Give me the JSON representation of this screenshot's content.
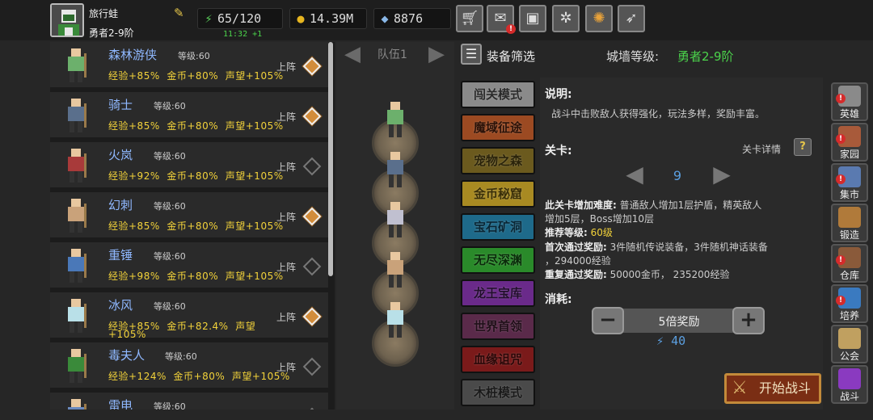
{
  "player": {
    "name": "旅行蛙",
    "rank": "勇者2-9阶",
    "avatar_icon": "pixel-knight-portrait"
  },
  "resources": {
    "stamina": "65/120",
    "stamina_regen": "11:32 +1",
    "gold": "14.39M",
    "gems": "8876"
  },
  "top_buttons": [
    {
      "name": "shop",
      "icon": "cart-icon"
    },
    {
      "name": "mail",
      "icon": "mail-icon",
      "badge": "!"
    },
    {
      "name": "game",
      "icon": "gamepad-icon"
    },
    {
      "name": "settings",
      "icon": "gear-icon"
    },
    {
      "name": "gacha",
      "icon": "color-wheel-icon"
    },
    {
      "name": "feather",
      "icon": "feather-icon"
    }
  ],
  "heroes": [
    {
      "name": "森林游侠",
      "level": "等级:60",
      "xp": "经验+85%",
      "gold": "金币+80%",
      "fame": "声望+105%",
      "deploy": "上阵",
      "active": true,
      "color": "#6cb06c"
    },
    {
      "name": "骑士",
      "level": "等级:60",
      "xp": "经验+85%",
      "gold": "金币+80%",
      "fame": "声望+105%",
      "deploy": "上阵",
      "active": true,
      "color": "#5a6f8c"
    },
    {
      "name": "火岚",
      "level": "等级:60",
      "xp": "经验+92%",
      "gold": "金币+80%",
      "fame": "声望+105%",
      "deploy": "上阵",
      "active": false,
      "color": "#a83a3a"
    },
    {
      "name": "幻刺",
      "level": "等级:60",
      "xp": "经验+85%",
      "gold": "金币+80%",
      "fame": "声望+105%",
      "deploy": "上阵",
      "active": true,
      "color": "#c9a27a"
    },
    {
      "name": "重锤",
      "level": "等级:60",
      "xp": "经验+98%",
      "gold": "金币+80%",
      "fame": "声望+105%",
      "deploy": "上阵",
      "active": false,
      "color": "#4a78b8"
    },
    {
      "name": "冰风",
      "level": "等级:60",
      "xp": "经验+85%",
      "gold": "金币+82.4%",
      "fame": "声望",
      "fame_wrap": "+105%",
      "deploy": "上阵",
      "active": true,
      "color": "#b9e0e8"
    },
    {
      "name": "毒夫人",
      "level": "等级:60",
      "xp": "经验+124%",
      "gold": "金币+80%",
      "fame": "声望+105%",
      "deploy": "上阵",
      "active": false,
      "color": "#3a8a3a"
    },
    {
      "name": "雷电",
      "level": "等级:60",
      "xp": "",
      "gold": "",
      "fame": "",
      "deploy": "",
      "active": false,
      "color": "#6a8abf"
    }
  ],
  "team": {
    "label": "队伍1",
    "slots": [
      "#6cb06c",
      "#5a6f8c",
      "#c0c0d0",
      "#c9a27a",
      "#b9e0e8"
    ]
  },
  "right_header": {
    "filter_label": "装备筛选",
    "wall_label": "城墙等级:",
    "wall_value": "勇者2-9阶"
  },
  "modes": [
    {
      "label": "闯关模式",
      "bg": "#8a8a8a",
      "fg": "#2a2a2a"
    },
    {
      "label": "魔域征途",
      "bg": "#9c4a22",
      "fg": "#2b1208"
    },
    {
      "label": "宠物之森",
      "bg": "#6b5a1e",
      "fg": "#2a230a"
    },
    {
      "label": "金币秘窟",
      "bg": "#a88a22",
      "fg": "#3a2f08"
    },
    {
      "label": "宝石矿洞",
      "bg": "#1e6a8a",
      "fg": "#0a2634"
    },
    {
      "label": "无尽深渊",
      "bg": "#2a8a2a",
      "fg": "#0a2a0a"
    },
    {
      "label": "龙王宝库",
      "bg": "#6a2a8a",
      "fg": "#22102c"
    },
    {
      "label": "世界首领",
      "bg": "#5a2a4a",
      "fg": "#201019"
    },
    {
      "label": "血缘诅咒",
      "bg": "#7a1a1a",
      "fg": "#2a0808"
    },
    {
      "label": "木桩模式",
      "bg": "#4a4a4a",
      "fg": "#1a1a1a"
    }
  ],
  "detail": {
    "desc_title": "说明:",
    "desc_text": "战斗中击败敌人获得强化，玩法多样，奖励丰富。",
    "stage_title": "关卡:",
    "stage_detail_label": "关卡详情",
    "stage_number": "9",
    "difficulty_label": "此关卡增加难度:",
    "difficulty_text1": "普通敌人增加1层护盾，精英敌人",
    "difficulty_text2": "增加5层，Boss增加10层",
    "recommend_label": "推荐等级:",
    "recommend_value": "60级",
    "first_reward_label": "首次通过奖励:",
    "first_reward_text1": "3件随机传说装备，3件随机神话装备",
    "first_reward_text2": "，294000经验",
    "repeat_reward_label": "重复通过奖励:",
    "repeat_reward_text": "50000金币， 235200经验",
    "cost_title": "消耗:",
    "multiplier_label": "5倍奖励",
    "cost_value": "40",
    "start_button": "开始战斗"
  },
  "side_nav": [
    {
      "label": "英雄",
      "color": "#8a8a8a",
      "badge": "!"
    },
    {
      "label": "家园",
      "color": "#a85a3a",
      "badge": "!"
    },
    {
      "label": "集市",
      "color": "#5a7ab0",
      "badge": "!"
    },
    {
      "label": "锻造",
      "color": "#b07a3a",
      "badge": ""
    },
    {
      "label": "仓库",
      "color": "#8a5a3a",
      "badge": "!"
    },
    {
      "label": "培养",
      "color": "#3a7ac0",
      "badge": "!"
    },
    {
      "label": "公会",
      "color": "#c0a060",
      "badge": ""
    },
    {
      "label": "战斗",
      "color": "#8a3ac0",
      "badge": ""
    }
  ]
}
